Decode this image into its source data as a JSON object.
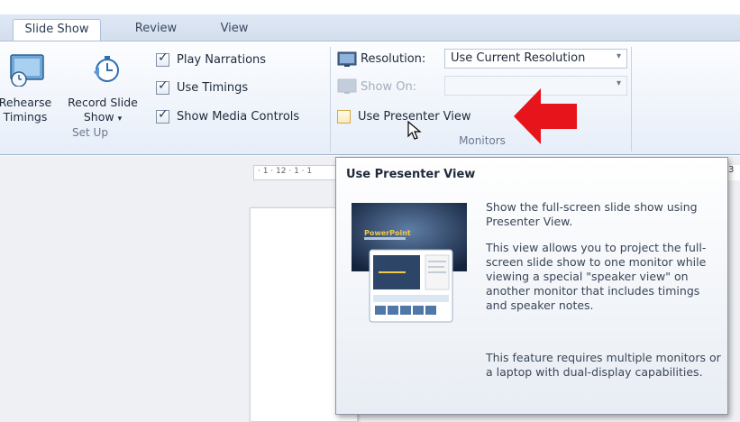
{
  "top_caption": "",
  "tabs": [
    {
      "label": "Slide Show",
      "active": true
    },
    {
      "label": "Review",
      "active": false
    },
    {
      "label": "View",
      "active": false
    }
  ],
  "setup_group": {
    "label": "Set Up",
    "rehearse_label_1": "Rehearse",
    "rehearse_label_2": "Timings",
    "record_label_1": "Record Slide",
    "record_label_2": "Show",
    "checkboxes": [
      {
        "label": "Play Narrations",
        "checked": true
      },
      {
        "label": "Use Timings",
        "checked": true
      },
      {
        "label": "Show Media Controls",
        "checked": true
      }
    ]
  },
  "monitors_group": {
    "label": "Monitors",
    "resolution_label": "Resolution:",
    "resolution_value": "Use Current Resolution",
    "show_on_label": "Show On:",
    "show_on_value": "",
    "presenter_view_label": "Use Presenter View",
    "presenter_view_checked": false
  },
  "ruler_text": "· 1 · 12 · 1 · 1",
  "ruler_right_digit": "3",
  "tooltip": {
    "title": "Use Presenter View",
    "para1": "Show the full-screen slide show using Presenter View.",
    "para2": "This view allows you to project the full-screen slide show to one monitor while viewing a special \"speaker view\" on another monitor that includes timings and speaker notes.",
    "para3": "This feature requires multiple monitors or a laptop with dual-display capabilities.",
    "preview_slide_text": "PowerPoint"
  },
  "colors": {
    "accent_red": "#e8141c",
    "ribbon_blue": "#dfe8f5",
    "tooltip_border": "#8d97a6"
  },
  "icons": [
    "rehearse-timings-icon",
    "record-slide-show-icon",
    "resolution-icon",
    "show-on-icon",
    "mouse-cursor-icon",
    "red-arrow-icon"
  ]
}
